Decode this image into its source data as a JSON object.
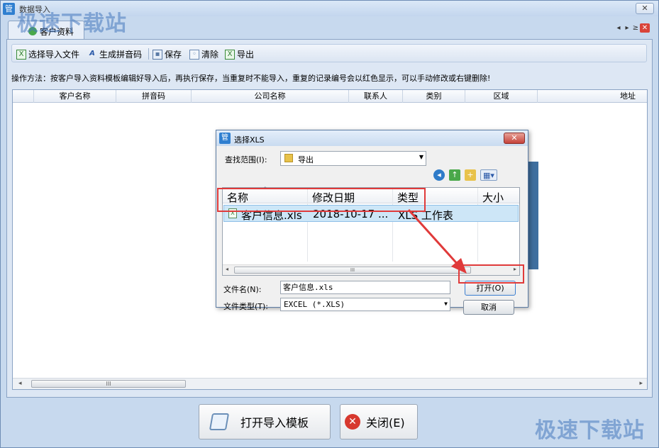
{
  "window": {
    "title": "数据导入",
    "close_symbol": "✕",
    "app_icon_glyph": "管"
  },
  "watermark": {
    "text": "极速下载站"
  },
  "tab": {
    "label": "客户资料",
    "ctrl_prev": "◂",
    "ctrl_next": "▸",
    "ctrl_menu": "≥",
    "ctrl_close": "✕"
  },
  "toolbar": {
    "select_file": "选择导入文件",
    "gen_pinyin": "生成拼音码",
    "save": "保存",
    "clear": "清除",
    "export": "导出"
  },
  "hint": "操作方法：按客户导入资料模板编辑好导入后，再执行保存，当重复时不能导入，重复的记录编号会以红色显示，可以手动修改或右键删除!",
  "grid": {
    "columns": [
      "客户名称",
      "拼音码",
      "公司名称",
      "联系人",
      "类别",
      "区域",
      "地址"
    ],
    "scroll_thumb": "III"
  },
  "buttons": {
    "open_template": "打开导入模板",
    "close": "关闭(E)"
  },
  "dialog": {
    "title": "选择XLS",
    "close_symbol": "✕",
    "app_icon_glyph": "管",
    "lookin_label": "查找范围(I):",
    "lookin_value": "导出",
    "columns": [
      "名称",
      "修改日期",
      "类型",
      "大小"
    ],
    "sort_glyph": "^",
    "file": {
      "name": "客户信息.xls",
      "date": "2018-10-17 ...",
      "type": "XLS 工作表"
    },
    "scroll_thumb": "III",
    "filename_label": "文件名(N):",
    "filename_value": "客户信息.xls",
    "filetype_label": "文件类型(T):",
    "filetype_value": "EXCEL (*.XLS)",
    "open_button": "打开(O)",
    "cancel_button": "取消"
  },
  "colors": {
    "highlight_red": "#e03a3a",
    "selection": "#cde6f7",
    "accent_blue": "#2f7fd0"
  }
}
